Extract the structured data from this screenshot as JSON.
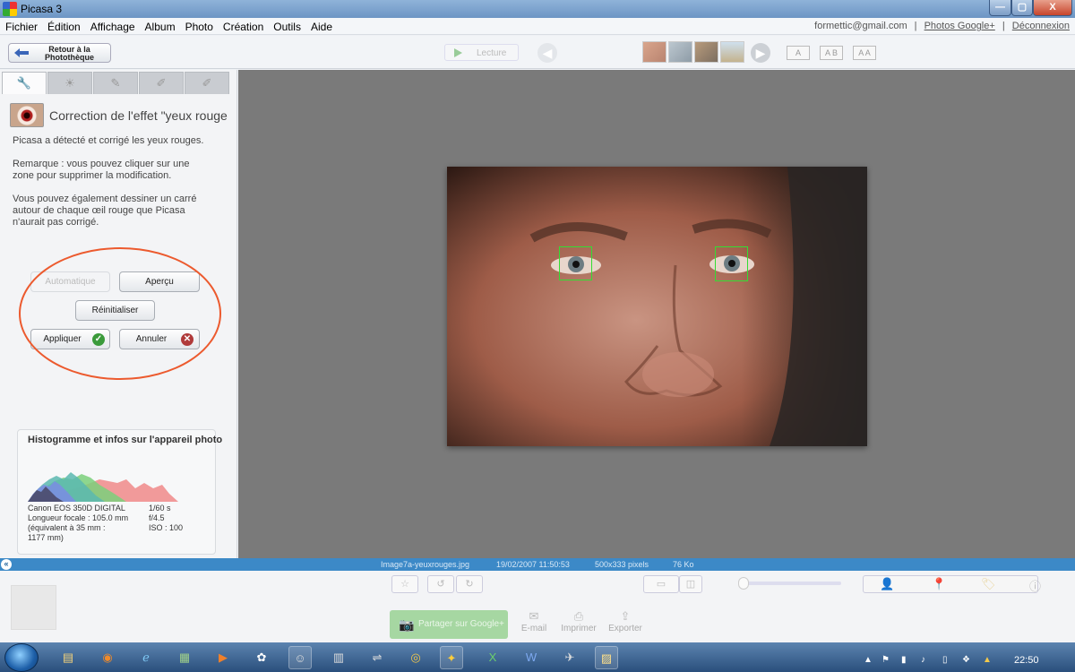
{
  "window": {
    "title": "Picasa 3",
    "min": "—",
    "max": "▢",
    "close": "X"
  },
  "menu": [
    "Fichier",
    "Édition",
    "Affichage",
    "Album",
    "Photo",
    "Création",
    "Outils",
    "Aide"
  ],
  "account": {
    "email": "formettic@gmail.com",
    "sep1": "|",
    "photos_link": "Photos Google+",
    "sep2": "|",
    "logout": "Déconnexion"
  },
  "toolbar": {
    "back_label_1": "Retour à la",
    "back_label_2": "Photothèque",
    "play_label": "Lecture",
    "text_size_buttons": [
      "A",
      "A B",
      "A A"
    ]
  },
  "tool_panel": {
    "tabs": [
      "wrench",
      "sun",
      "brush",
      "effects",
      "effects2"
    ],
    "title": "Correction de l'effet \"yeux rouge",
    "para1": "Picasa a détecté et corrigé les yeux rouges.",
    "para2": "Remarque : vous pouvez cliquer sur une zone pour supprimer la modification.",
    "para3": "Vous pouvez également dessiner un carré autour de chaque œil rouge que Picasa n'aurait pas corrigé.",
    "btn_auto": "Automatique",
    "btn_preview": "Aperçu",
    "btn_reset": "Réinitialiser",
    "btn_apply": "Appliquer",
    "btn_cancel": "Annuler"
  },
  "histogram": {
    "title": "Histogramme et infos sur l'appareil photo",
    "camera": "Canon EOS 350D DIGITAL",
    "focal": "Longueur focale : 105.0 mm",
    "equiv_1": "(équivalent à 35 mm :",
    "equiv_2": "1177 mm)",
    "shutter": "1/60 s",
    "aperture": "f/4.5",
    "iso": "ISO : 100",
    "colors": {
      "red": "#f08a8a",
      "green": "#7bd07b",
      "blue": "#7a8fe0",
      "teal": "#5bb9b0",
      "dark": "#4a4a6a"
    }
  },
  "status": {
    "filename": "Image7a-yeuxrouges.jpg",
    "date": "19/02/2007 11:50:53",
    "dims": "500x333 pixels",
    "size": "76 Ko"
  },
  "tray": {
    "share_label": "Partager sur Google+",
    "email_label": "E-mail",
    "print_label": "Imprimer",
    "export_label": "Exporter"
  },
  "taskbar": {
    "clock": "22:50"
  }
}
